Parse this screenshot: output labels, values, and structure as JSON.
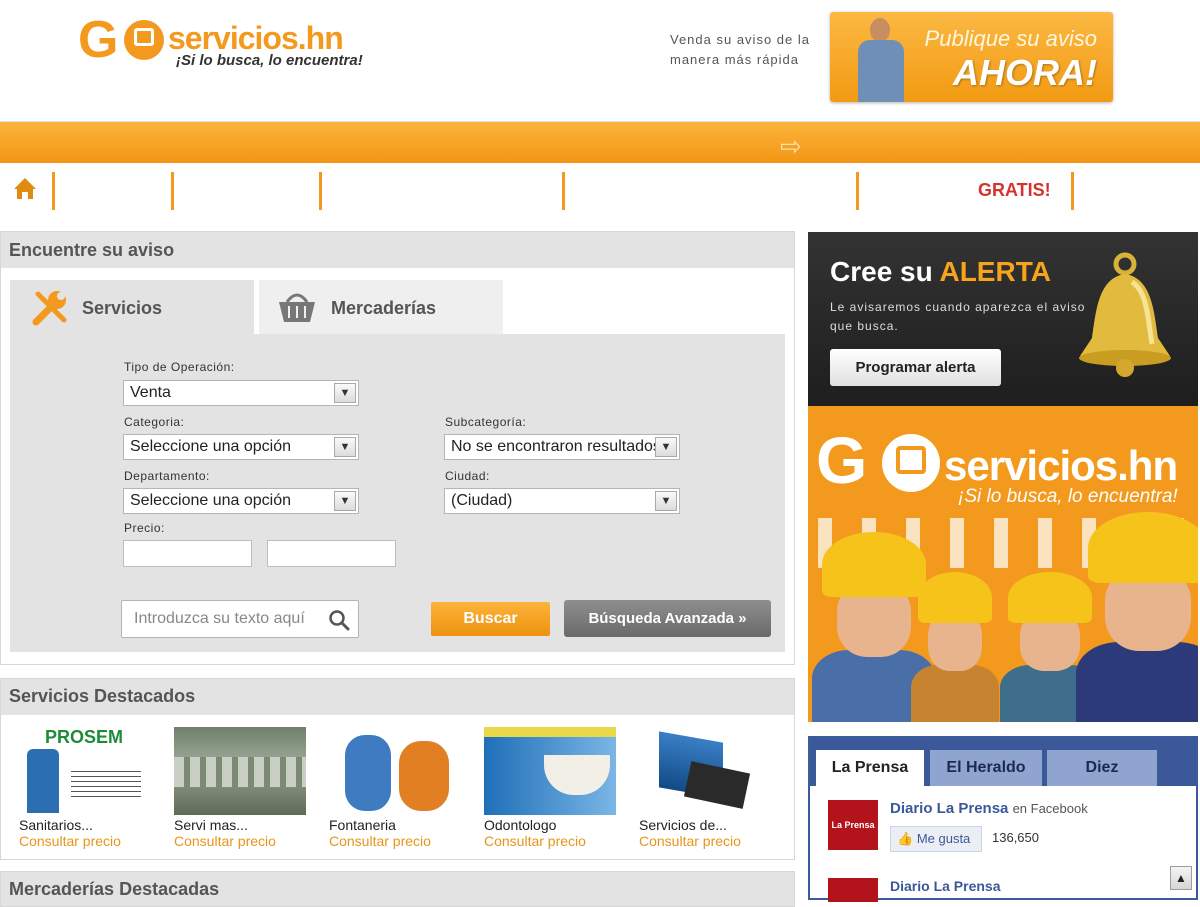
{
  "header": {
    "logo_go": "GO",
    "logo_domain": "servicios.hn",
    "logo_slogan": "¡Si lo busca, lo encuentra!",
    "sell_text": "Venda su aviso de la manera más rápida",
    "publish_line1": "Publique su aviso",
    "publish_line2": "AHORA!"
  },
  "nav": {
    "gratis_label": "GRATIS!"
  },
  "search": {
    "title": "Encuentre su aviso",
    "tabs": [
      {
        "label": "Servicios",
        "icon": "wrench-icon"
      },
      {
        "label": "Mercaderías",
        "icon": "basket-icon"
      }
    ],
    "fields": {
      "tipo_label": "Tipo de Operación:",
      "tipo_value": "Venta",
      "categoria_label": "Categoria:",
      "categoria_value": "Seleccione una opción",
      "subcategoria_label": "Subcategoría:",
      "subcategoria_value": "No se encontraron resultados",
      "departamento_label": "Departamento:",
      "departamento_value": "Seleccione una opción",
      "ciudad_label": "Ciudad:",
      "ciudad_value": "(Ciudad)",
      "precio_label": "Precio:"
    },
    "search_placeholder": "Introduzca su texto aquí",
    "buscar_label": "Buscar",
    "avanzada_label": "Búsqueda Avanzada »"
  },
  "featured": {
    "title": "Servicios Destacados",
    "items": [
      {
        "name": "Sanitarios...",
        "price": "Consultar precio",
        "brand": "PROSEM"
      },
      {
        "name": "Servi mas...",
        "price": "Consultar precio"
      },
      {
        "name": "Fontaneria",
        "price": "Consultar precio"
      },
      {
        "name": "Odontologo",
        "price": "Consultar precio"
      },
      {
        "name": "Servicios de...",
        "price": "Consultar precio"
      }
    ]
  },
  "mercaderias_title": "Mercaderías Destacadas",
  "alert": {
    "title_plain": "Cree su",
    "title_highlight": "ALERTA",
    "subtitle": "Le avisaremos cuando aparezca el aviso que busca.",
    "button": "Programar alerta"
  },
  "ad": {
    "go": "G",
    "domain": "servicios.hn",
    "slogan": "¡Si lo busca, lo encuentra!"
  },
  "news": {
    "tabs": [
      "La Prensa",
      "El Heraldo",
      "Diez"
    ],
    "fb_name": "Diario La Prensa",
    "fb_en": "en Facebook",
    "like_label": "Me gusta",
    "like_count": "136,650",
    "fb_name2": "Diario La Prensa",
    "logo_text": "La Prensa"
  },
  "colors": {
    "brand_orange": "#f39a1e",
    "alert_red": "#d6322d",
    "fb_blue": "#3b5998"
  }
}
